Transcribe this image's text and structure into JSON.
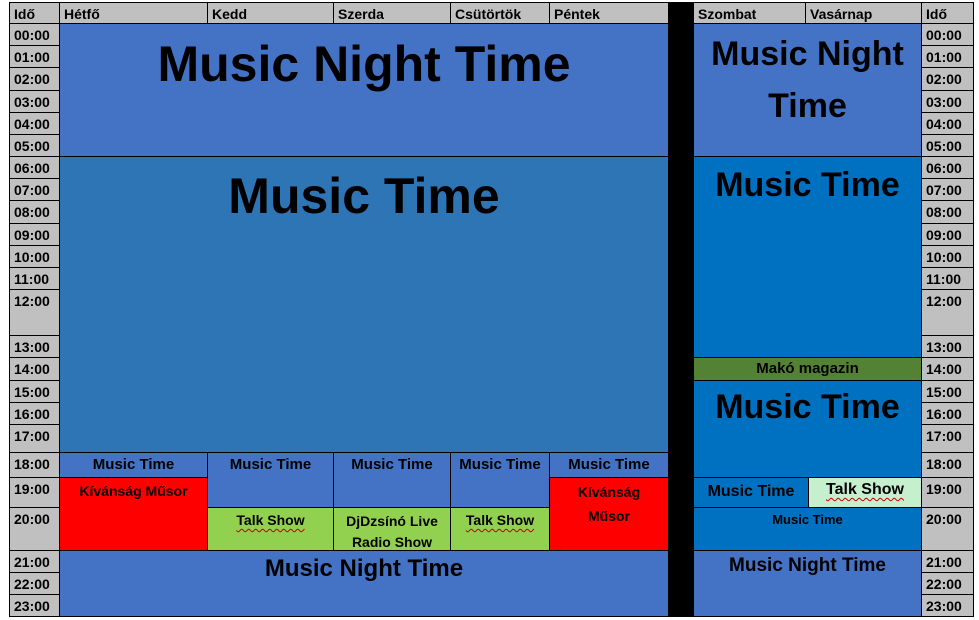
{
  "headers": {
    "ido": "Idő",
    "days": [
      "Hétfő",
      "Kedd",
      "Szerda",
      "Csütörtök",
      "Péntek",
      "Szombat",
      "Vasárnap"
    ]
  },
  "times": [
    "00:00",
    "01:00",
    "02:00",
    "03:00",
    "04:00",
    "05:00",
    "06:00",
    "07:00",
    "08:00",
    "09:00",
    "10:00",
    "11:00",
    "12:00",
    "13:00",
    "14:00",
    "15:00",
    "16:00",
    "17:00",
    "18:00",
    "19:00",
    "20:00",
    "21:00",
    "22:00",
    "23:00"
  ],
  "weekday": {
    "night_top": "Music Night Time",
    "music_time": "Music Time",
    "row18": [
      "Music Time",
      "Music Time",
      "Music Time",
      "Music Time",
      "Music Time"
    ],
    "kivansag_mon": "Kívánság Műsor",
    "kivansag_fri": "Kívánság Műsor",
    "talk_tue": "Talk Show",
    "djdzsino": "DjDzsínó Live Radio Show",
    "talk_thu": "Talk Show",
    "night_bottom": "Music Night Time"
  },
  "weekend": {
    "night_top": "Music Night Time",
    "music_time_morning": "Music Time",
    "mako": "Makó magazin",
    "music_time_afternoon": "Music Time",
    "music_time_19": "Music Time",
    "talk_19": "Talk Show",
    "music_time_20": "Music Time",
    "night_bottom": "Music Night Time"
  },
  "colors": {
    "header_gray": "#c0c0c0",
    "night_blue": "#4472c4",
    "music_blue": "#2e75b6",
    "weekend_blue": "#0070c0",
    "red": "#ff0000",
    "green": "#92d050",
    "light_green": "#c6efce",
    "dark_green": "#548235"
  }
}
